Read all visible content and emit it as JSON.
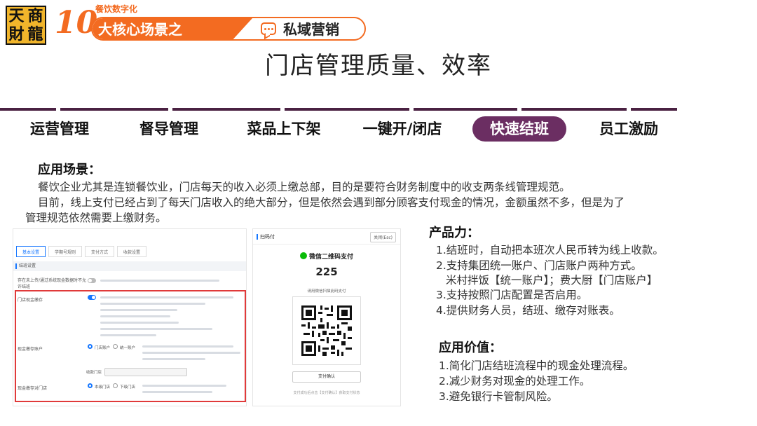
{
  "logo": {
    "chars": [
      "天",
      "商",
      "財",
      "龍"
    ]
  },
  "banner": {
    "number": "10",
    "small_title": "餐饮数字化",
    "main_title": "大核心场景之",
    "topic": "私域营销"
  },
  "page_title": "门店管理质量、效率",
  "tabs": [
    {
      "label": "运营管理",
      "active": false
    },
    {
      "label": "督导管理",
      "active": false
    },
    {
      "label": "菜品上下架",
      "active": false
    },
    {
      "label": "一键开/闭店",
      "active": false
    },
    {
      "label": "快速结班",
      "active": true
    },
    {
      "label": "员工激励",
      "active": false
    }
  ],
  "scenario": {
    "heading": "应用场景：",
    "line1": "餐饮企业尤其是连锁餐饮业，门店每天的收入必须上缴总部，目的是要符合财务制度中的收支两条线管理规范。",
    "line2": "目前，线上支付已经占到了每天门店收入的绝大部分，但是依然会遇到部分顾客支付现金的情况，金额虽然不多，但是为了",
    "line3": "管理规范依然需要上缴财务。"
  },
  "screenshot_settings": {
    "subtabs": [
      "基本设置",
      "学期号规则",
      "支付方式",
      "收款设置"
    ],
    "section_header": "结班设置",
    "row1_label": "存在未上传/通过系统现金数据时不允许结班",
    "row2_label": "门店现金缴存",
    "row3_label": "现金缴存账户",
    "row3_options": [
      "门店账户",
      "统一账户"
    ],
    "row3_select_label": "收款门店",
    "row4_label": "现金缴存对门店",
    "row4_options": [
      "本级门店",
      "下级门店"
    ]
  },
  "screenshot_pay": {
    "title": "扫码付",
    "close": "关闭(Esc)",
    "method": "微信二维码支付",
    "amount": "225",
    "hint": "请用微信扫描此码支付",
    "confirm": "支付确认",
    "footnote": "支付成功后点击【支付确认】获取支付状态"
  },
  "product": {
    "heading": "产品力：",
    "items": [
      "1.结班时，自动把本班次人民币转为线上收款。",
      "2.支持集团统一账户、门店账户两种方式。",
      "米村拌饭【统一账户】；费大厨【门店账户】",
      "3.支持按照门店配置是否启用。",
      "4.提供财务人员，结班、缴存对账表。"
    ]
  },
  "value": {
    "heading": "应用价值：",
    "items": [
      "1.简化门店结班流程中的现金处理流程。",
      "2.减少财务对现金的处理工作。",
      "3.避免银行卡管制风险。"
    ]
  },
  "colors": {
    "accent_orange": "#f36b21",
    "tab_active": "#6b2e62",
    "logo_gold": "#f1b52b",
    "highlight_red": "#e03a3a"
  }
}
